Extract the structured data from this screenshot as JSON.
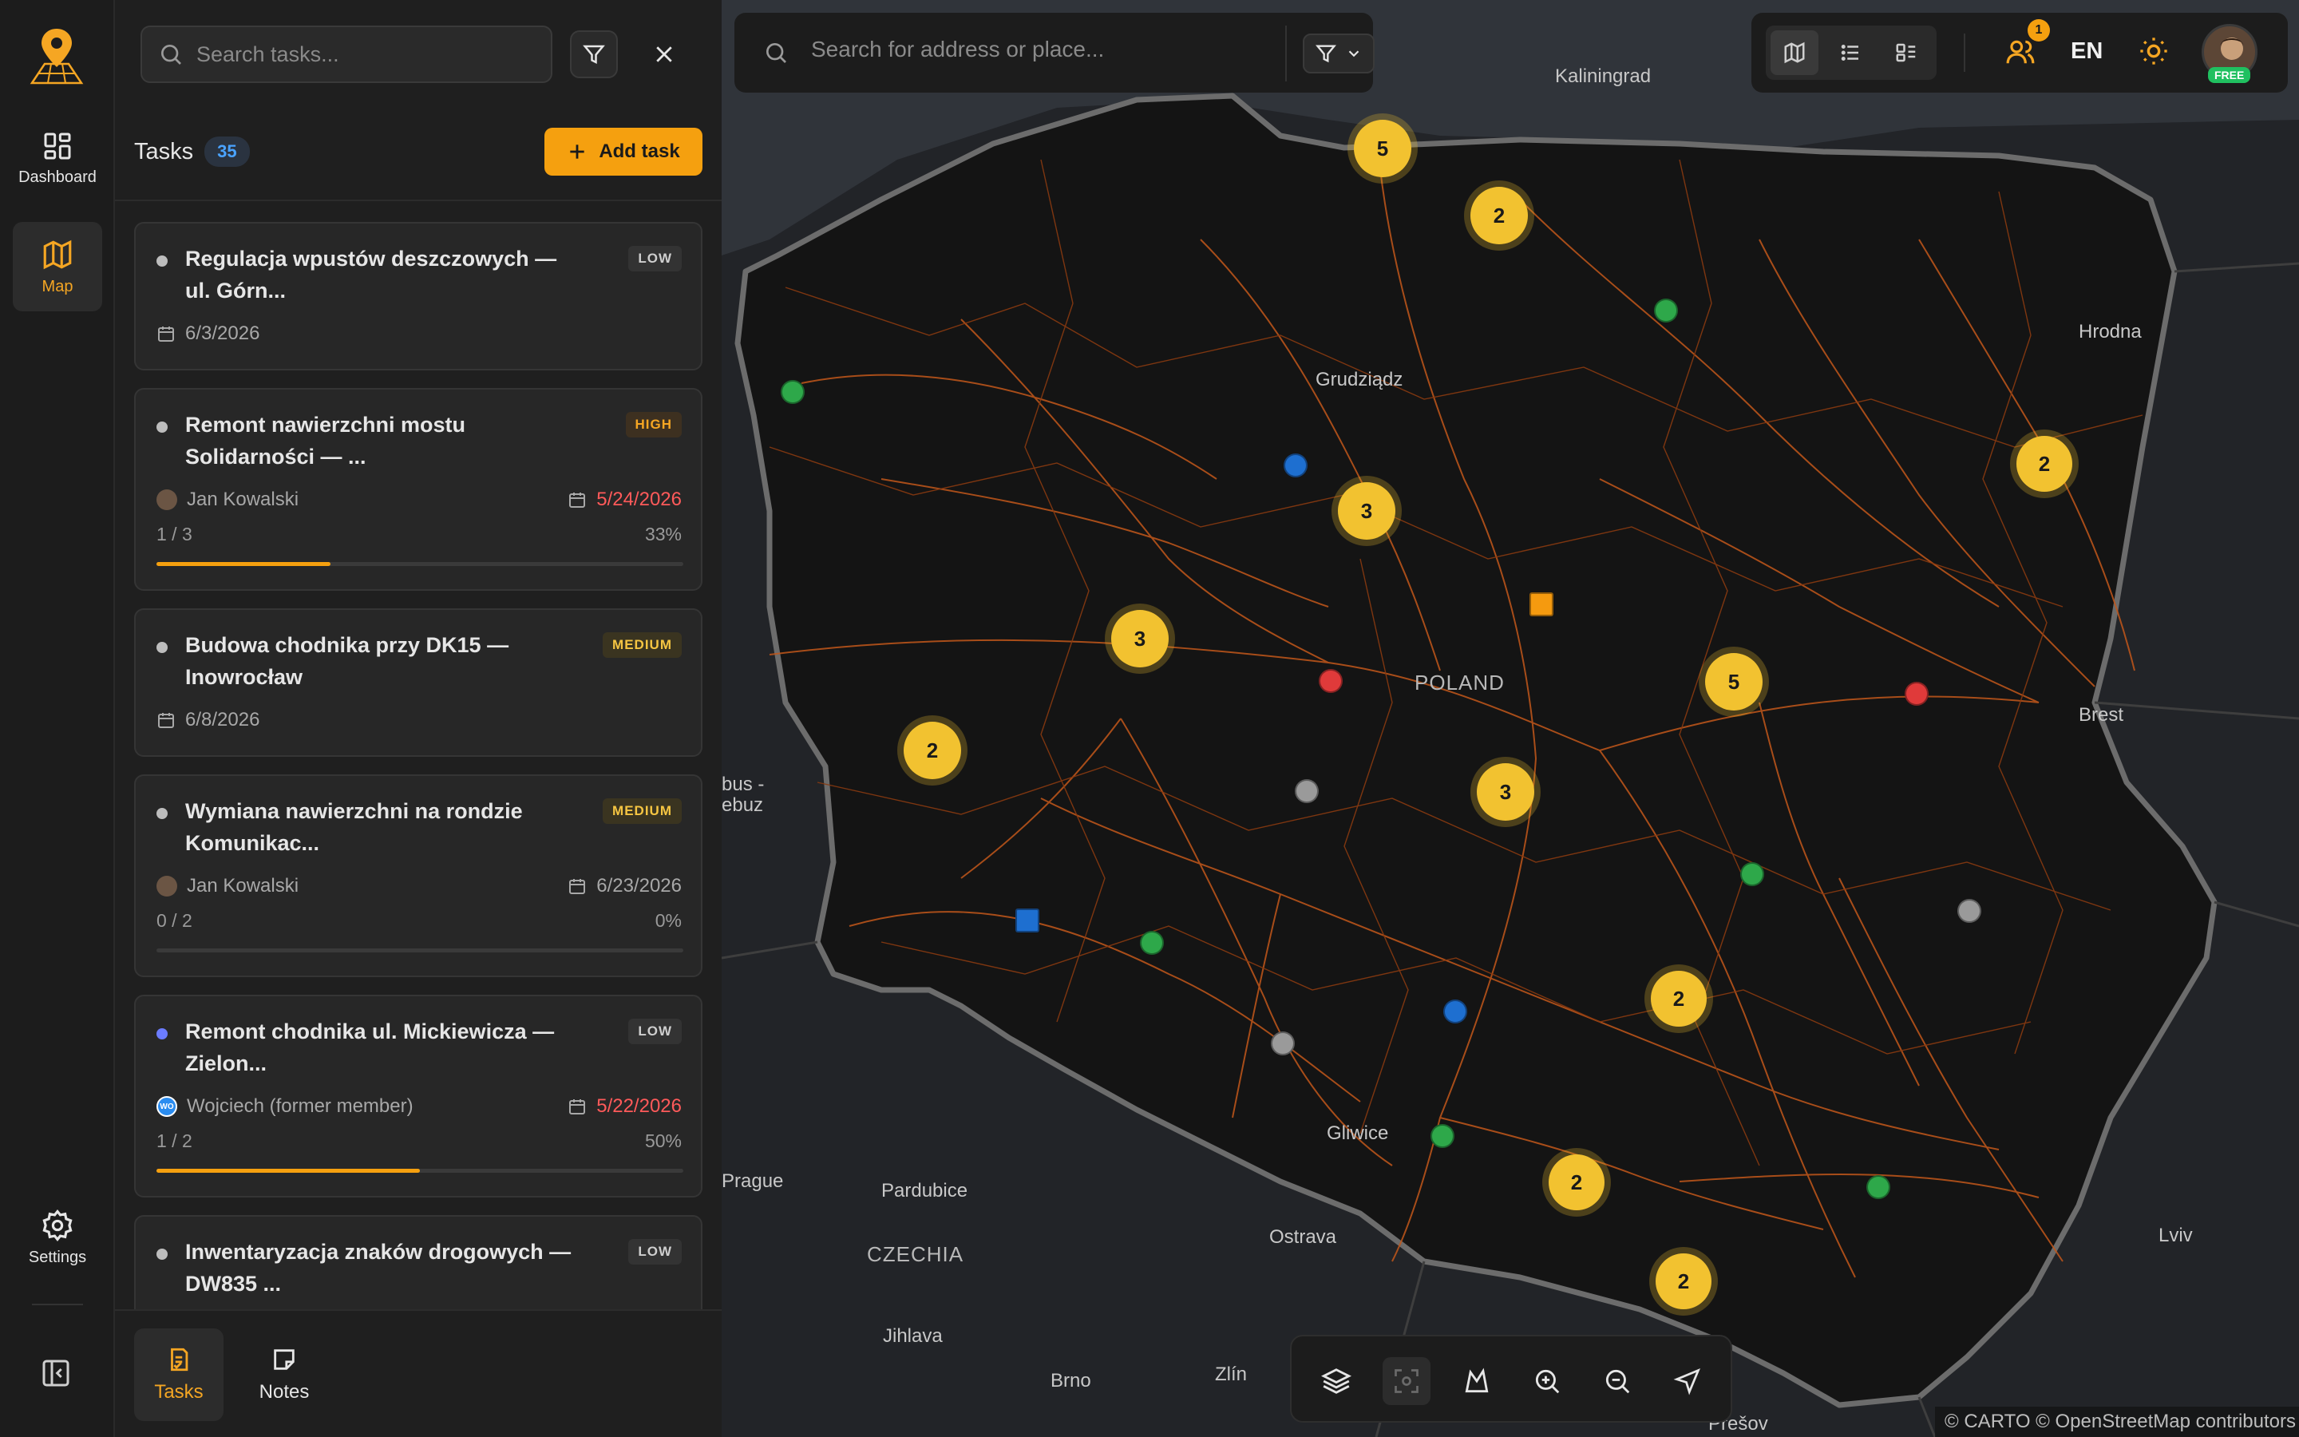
{
  "rail": {
    "items": [
      {
        "label": "Dashboard",
        "icon": "dashboard-icon"
      },
      {
        "label": "Map",
        "icon": "map-icon",
        "active": true
      },
      {
        "label": "Settings",
        "icon": "gear-icon"
      }
    ]
  },
  "panel": {
    "search_placeholder": "Search tasks...",
    "tasks_label": "Tasks",
    "tasks_count": "35",
    "add_task_label": "Add task",
    "tasks": [
      {
        "title": "Regulacja wpustów deszczowych — ul. Górn...",
        "priority": "LOW",
        "date": "6/3/2026"
      },
      {
        "title": "Remont nawierzchni mostu Solidarności — ...",
        "priority": "HIGH",
        "assignee": "Jan Kowalski",
        "due": "5/24/2026",
        "progress_text": "1 / 3",
        "progress_pct": "33%",
        "progress": 0.33
      },
      {
        "title": "Budowa chodnika przy DK15 — Inowrocław",
        "priority": "MEDIUM",
        "date": "6/8/2026"
      },
      {
        "title": "Wymiana nawierzchni na rondzie Komunikac...",
        "priority": "MEDIUM",
        "assignee": "Jan Kowalski",
        "due": "6/23/2026",
        "progress_text": "0 / 2",
        "progress_pct": "0%",
        "progress": 0
      },
      {
        "title": "Remont chodnika ul. Mickiewicza — Zielon...",
        "priority": "LOW",
        "assignee": "Wojciech (former member)",
        "assignee_initials": "WO",
        "due": "5/22/2026",
        "progress_text": "1 / 2",
        "progress_pct": "50%",
        "progress": 0.5
      },
      {
        "title": "Inwentaryzacja znaków drogowych — DW835 ...",
        "priority": "LOW"
      }
    ],
    "bottom_tabs": [
      {
        "label": "Tasks",
        "active": true
      },
      {
        "label": "Notes"
      }
    ]
  },
  "map": {
    "search_placeholder": "Search for address or place...",
    "lang": "EN",
    "notif_count": "1",
    "plan_badge": "FREE",
    "attribution": "© CARTO © OpenStreetMap contributors",
    "labels": {
      "kaliningrad": "Kaliningrad",
      "grudziadz": "Grudziądz",
      "hrodna": "Hrodna",
      "poland": "POLAND",
      "brest": "Brest",
      "zielona": "bus -\nebuz",
      "prague": "Prague",
      "pardubice": "Pardubice",
      "czechia": "CZECHIA",
      "ostrava": "Ostrava",
      "gliwice": "Gliwice",
      "jihlava": "Jihlava",
      "brno": "Brno",
      "zlin": "Zlín",
      "presov": "Prešov",
      "lviv": "Lviv"
    },
    "clusters": [
      "5",
      "2",
      "2",
      "3",
      "3",
      "5",
      "2",
      "3",
      "2",
      "2",
      "2"
    ],
    "colors": {
      "accent": "#f5a00f",
      "cluster": "#f2c230",
      "green": "#2ea84a",
      "blue": "#1e6fd0",
      "red": "#e03a3a",
      "gray": "#9a9a9a",
      "orange": "#f59a0f"
    }
  }
}
